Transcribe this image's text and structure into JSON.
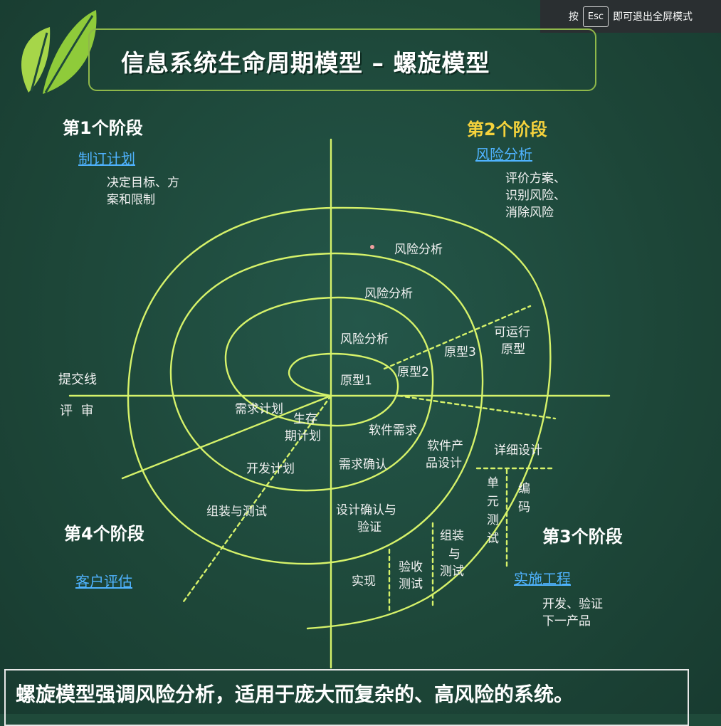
{
  "esc_hint": {
    "prefix": "按",
    "key": "Esc",
    "suffix": "即可退出全屏模式"
  },
  "title": "信息系统生命周期模型 – 螺旋模型",
  "stages": {
    "s1": {
      "title": "第1个阶段",
      "link": "制订计划",
      "desc_line1": "决定目标、方",
      "desc_line2": "案和限制"
    },
    "s2": {
      "title": "第2个阶段",
      "link": "风险分析",
      "desc_line1": "评价方案、",
      "desc_line2": "识别风险、",
      "desc_line3": "消除风险"
    },
    "s3": {
      "title": "第3个阶段",
      "link": "实施工程",
      "desc_line1": "开发、验证",
      "desc_line2": "下一产品"
    },
    "s4": {
      "title": "第4个阶段",
      "link": "客户评估"
    }
  },
  "left_labels": {
    "commit": "提交线",
    "review": "评  审"
  },
  "diagram": {
    "risk1": "风险分析",
    "risk2": "风险分析",
    "risk3": "风险分析",
    "proto1": "原型1",
    "proto2": "原型2",
    "proto3": "原型3",
    "runnable_l1": "可运行",
    "runnable_l2": "原型",
    "req_plan": "需求计划",
    "life_l1": "生存",
    "life_l2": "期计划",
    "dev_plan": "开发计划",
    "integrate_test": "组装与测试",
    "sw_req": "软件需求",
    "req_confirm": "需求确认",
    "prod_design_l1": "软件产",
    "prod_design_l2": "品设计",
    "design_confirm_l1": "设计确认与",
    "design_confirm_l2": "验证",
    "detail_design": "详细设计",
    "unit_test": [
      "单",
      "元",
      "测",
      "试"
    ],
    "coding": [
      "编",
      "码"
    ],
    "assembly_test": [
      "组装",
      "与",
      "测试"
    ],
    "acceptance": [
      "验收",
      "测试"
    ],
    "implement": "实现"
  },
  "footer": "螺旋模型强调风险分析，适用于庞大而复杂的、高风险的系统。",
  "colors": {
    "board": "#1f4a3a",
    "line": "#d6f26a",
    "stage2": "#f5d23c",
    "link": "#4fb3ff",
    "leaf": "#a6d649"
  }
}
